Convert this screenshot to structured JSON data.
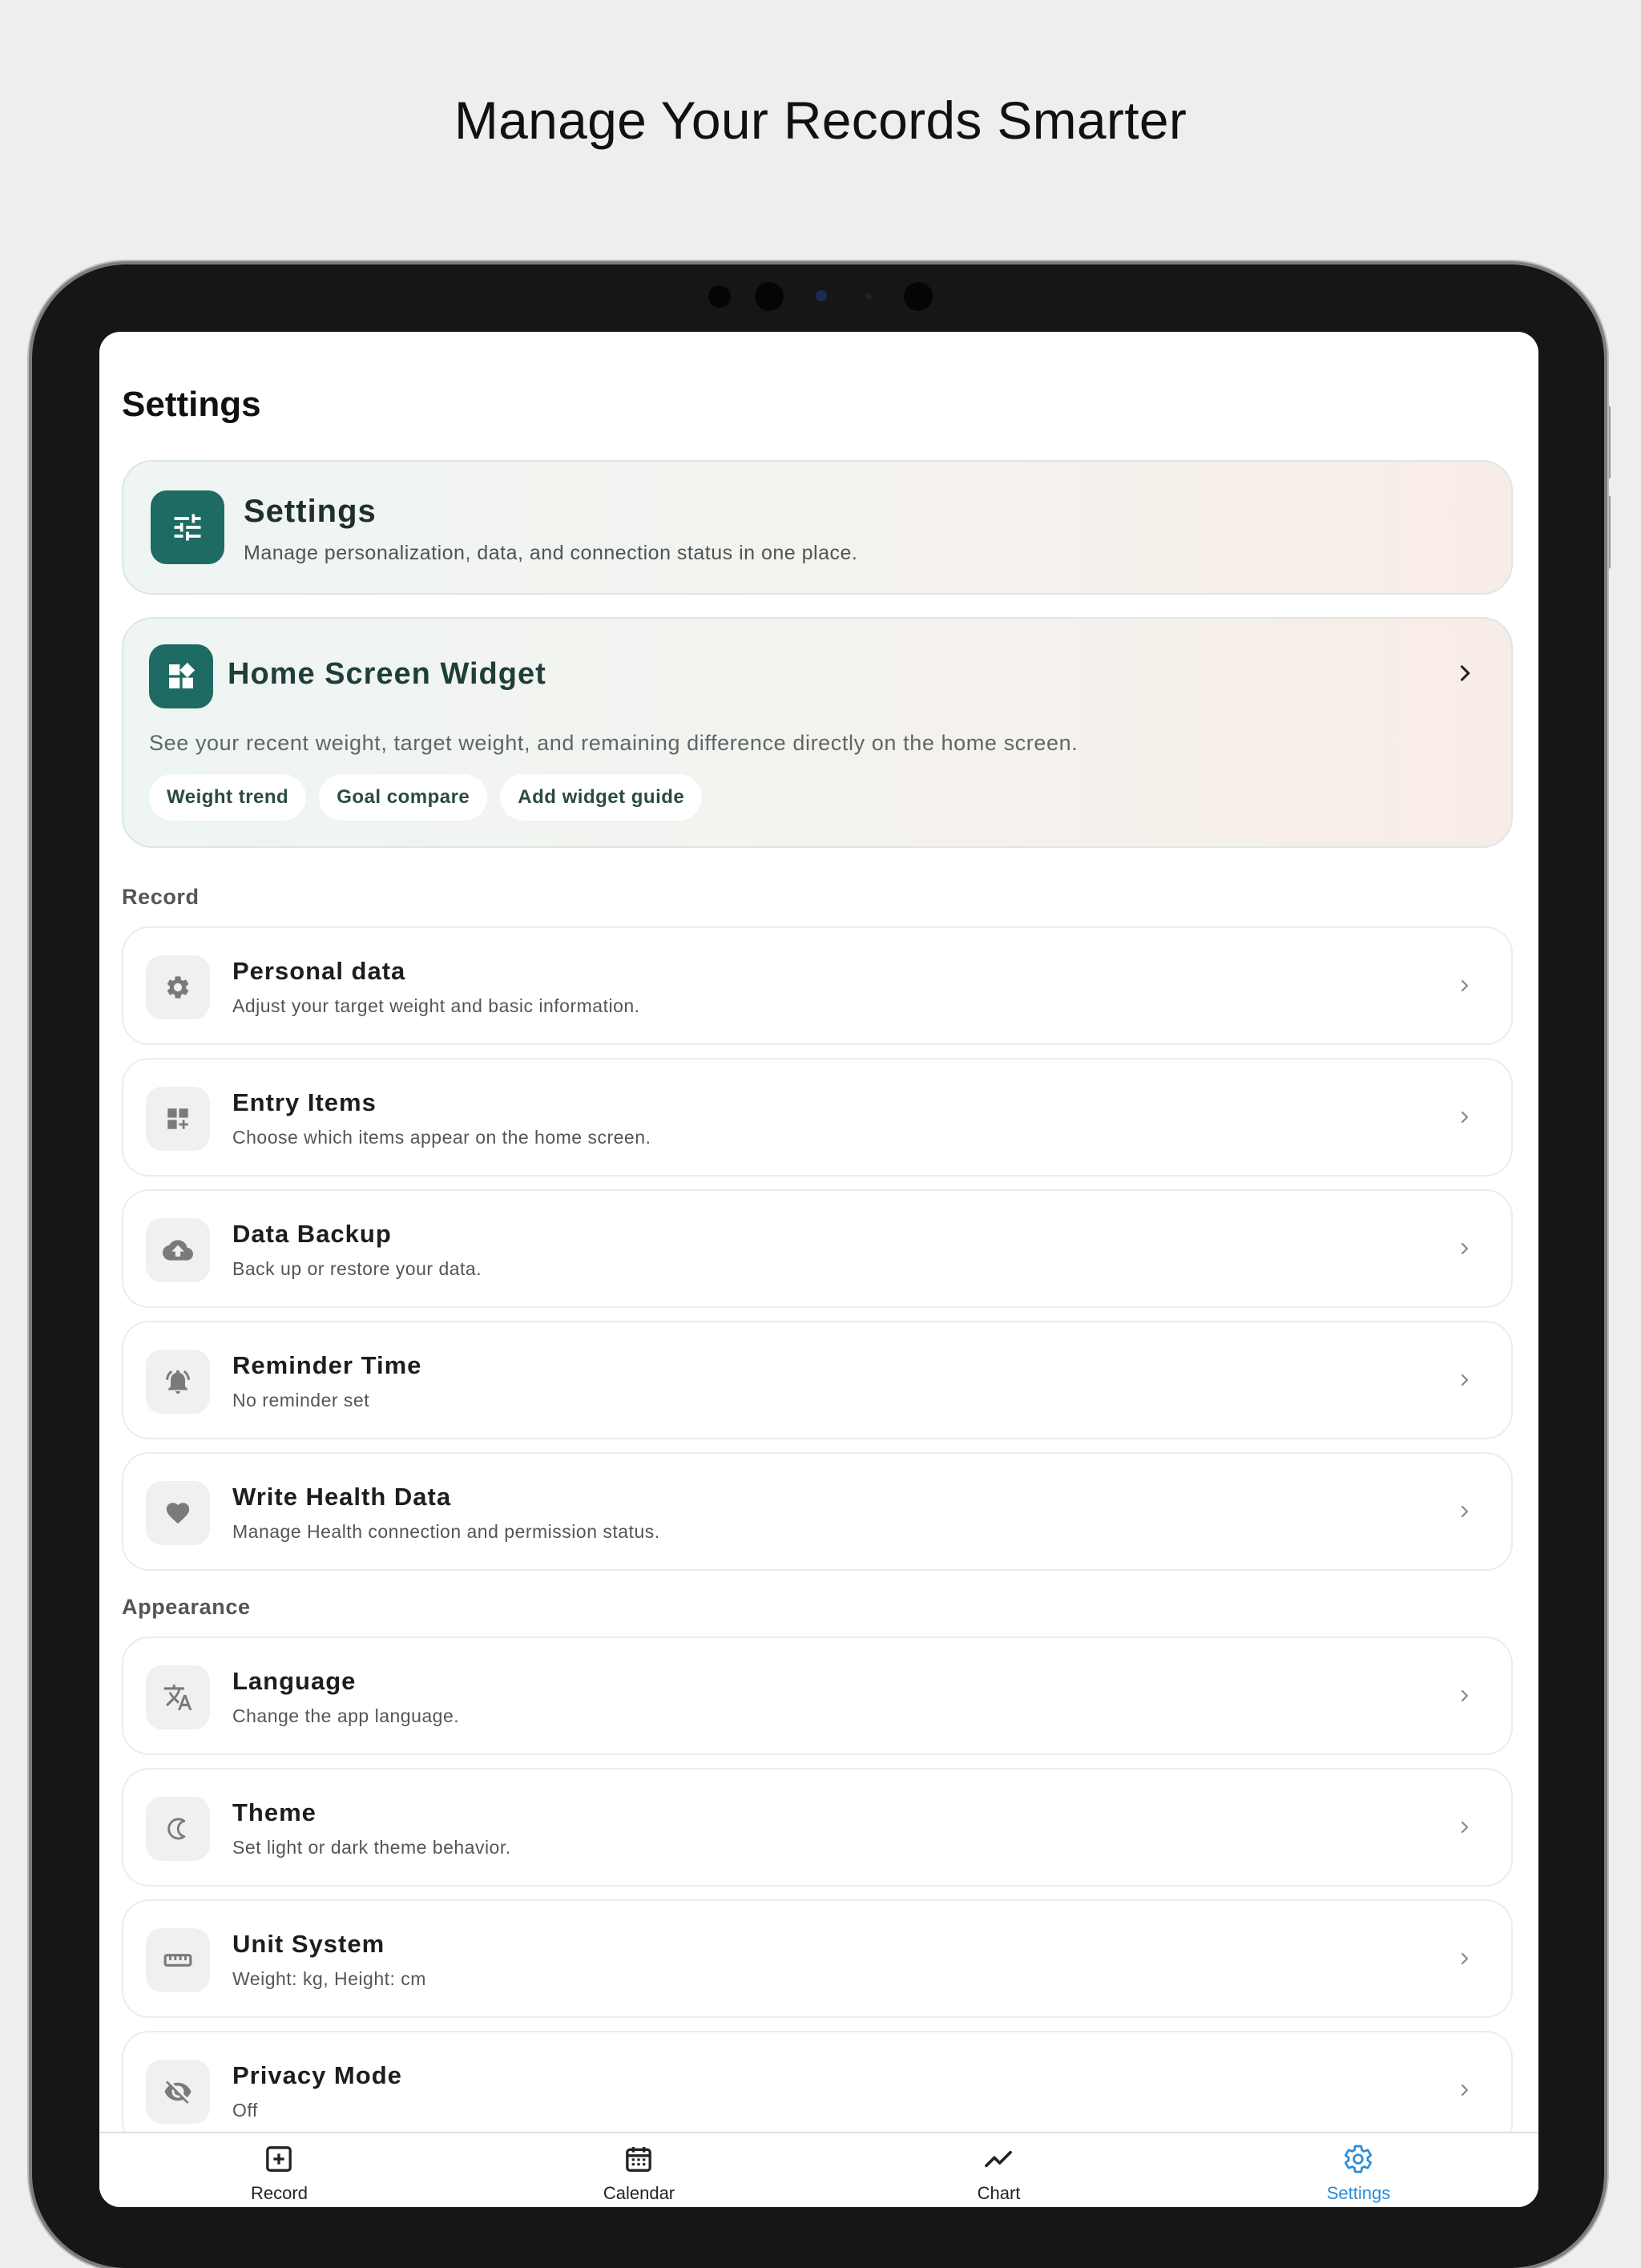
{
  "headline": "Manage Your Records Smarter",
  "page_title": "Settings",
  "header_card": {
    "title": "Settings",
    "subtitle": "Manage personalization, data, and connection status in one place.",
    "icon": "tune-icon"
  },
  "widget_card": {
    "title": "Home Screen Widget",
    "description": "See your recent weight, target weight, and remaining difference directly on the home screen.",
    "icon": "widgets-icon",
    "chips": [
      "Weight trend",
      "Goal compare",
      "Add widget guide"
    ]
  },
  "sections": {
    "record": {
      "label": "Record",
      "items": [
        {
          "title": "Personal data",
          "subtitle": "Adjust your target weight and basic information.",
          "icon": "gear-icon"
        },
        {
          "title": "Entry Items",
          "subtitle": "Choose which items appear on the home screen.",
          "icon": "dashboard-add-icon"
        },
        {
          "title": "Data Backup",
          "subtitle": "Back up or restore your data.",
          "icon": "cloud-upload-icon"
        },
        {
          "title": "Reminder Time",
          "subtitle": "No reminder set",
          "icon": "alarm-icon"
        },
        {
          "title": "Write Health Data",
          "subtitle": "Manage Health connection and permission status.",
          "icon": "heart-icon"
        }
      ]
    },
    "appearance": {
      "label": "Appearance",
      "items": [
        {
          "title": "Language",
          "subtitle": "Change the app language.",
          "icon": "translate-icon"
        },
        {
          "title": "Theme",
          "subtitle": "Set light or dark theme behavior.",
          "icon": "moon-icon"
        },
        {
          "title": "Unit System",
          "subtitle": "Weight: kg, Height: cm",
          "icon": "ruler-icon"
        },
        {
          "title": "Privacy Mode",
          "subtitle": "Off",
          "icon": "eye-off-icon"
        }
      ]
    }
  },
  "tabs": [
    {
      "label": "Record",
      "icon": "add-box-icon",
      "active": false
    },
    {
      "label": "Calendar",
      "icon": "calendar-icon",
      "active": false
    },
    {
      "label": "Chart",
      "icon": "trend-icon",
      "active": false
    },
    {
      "label": "Settings",
      "icon": "gear-icon",
      "active": true
    }
  ],
  "colors": {
    "accent_teal": "#1e6b63",
    "active_tab": "#2a8bd6",
    "background": "#eeeeee"
  }
}
